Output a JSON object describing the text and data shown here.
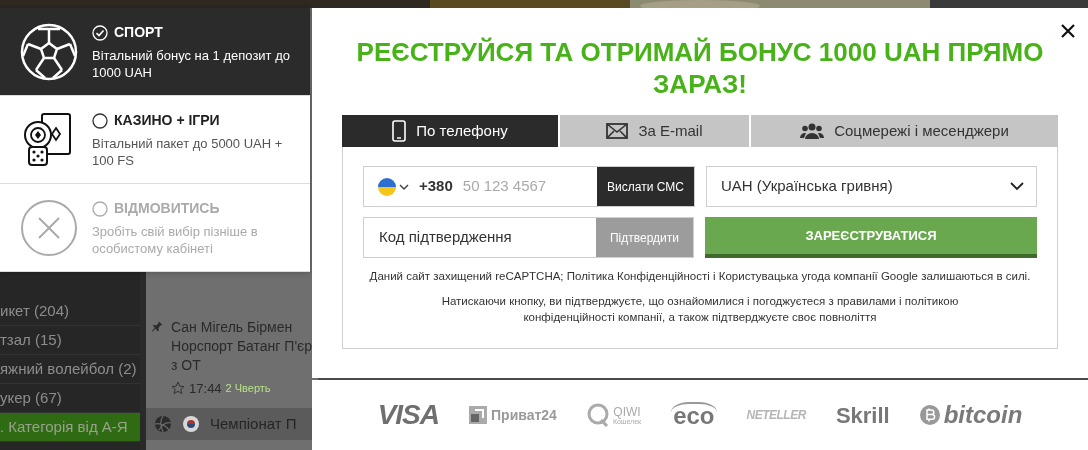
{
  "background": {
    "sidebar_items": [
      {
        "label": "икет (204)",
        "selected": false
      },
      {
        "label": "тзал (15)",
        "selected": false
      },
      {
        "label": "яжний волейбол (2)",
        "selected": false
      },
      {
        "label": "укер (67)",
        "selected": false
      },
      {
        "label": ". Категорія від А-Я",
        "selected": true
      }
    ],
    "event": {
      "lines": [
        "Сан Мігель Бірмен",
        "Норспорт Батанг П'єр",
        "з ОТ"
      ],
      "time": "17:44",
      "period": "2 Чверть"
    },
    "league": {
      "name": "Чемпіонат П"
    }
  },
  "bonus_options": [
    {
      "kind": "sport",
      "title": "СПОРТ",
      "description": "Вітальний бонус на 1 депозит до 1000 UAH",
      "selected": true
    },
    {
      "kind": "casino",
      "title": "КАЗИНО + ІГРИ",
      "description": "Вітальний пакет до 5000 UAH + 100 FS",
      "selected": false
    },
    {
      "kind": "decline",
      "title": "ВІДМОВИТИСЬ",
      "description": "Зробіть свій вибір пізніше в особистому кабінеті",
      "selected": false
    }
  ],
  "modal": {
    "title": "РЕЄСТРУЙСЯ ТА ОТРИМАЙ БОНУС 1000 UAH ПРЯМО ЗАРАЗ!",
    "tabs": [
      {
        "kind": "phone",
        "label": "По телефону",
        "selected": true
      },
      {
        "kind": "email",
        "label": "За E-mail",
        "selected": false
      },
      {
        "kind": "social",
        "label": "Соцмережі і месенджери",
        "selected": false
      }
    ],
    "phone": {
      "country_code": "+380",
      "placeholder": "50 123 4567",
      "send_button": "Вислати СМС"
    },
    "currency": {
      "value": "UAH (Українська гривня)"
    },
    "code": {
      "placeholder": "Код підтвердження",
      "confirm_button": "Підтвердити"
    },
    "submit_button": "ЗАРЕЄСТРУВАТИСЯ",
    "notes": [
      [
        {
          "text": "Даний сайт захищений reCAPTCHA; ",
          "kind": "text"
        },
        {
          "text": "Політика Конфіденційності",
          "kind": "link"
        },
        {
          "text": " і ",
          "kind": "text"
        },
        {
          "text": "Користувацька угода",
          "kind": "link"
        },
        {
          "text": " компанії Google залишаються в силі.",
          "kind": "text"
        }
      ],
      [
        {
          "text": "Натискаючи кнопку, ви підтверджуєте, що ознайомилися і погоджуєтеся з ",
          "kind": "text"
        },
        {
          "text": "правилами",
          "kind": "link"
        },
        {
          "text": " і ",
          "kind": "text"
        },
        {
          "text": "політикою",
          "kind": "link"
        },
        {
          "text": " конфіденційності компанії, а також підтверджуєте своє повноліття",
          "kind": "text"
        }
      ]
    ]
  },
  "payment_methods": [
    {
      "kind": "visa",
      "text": "VISA"
    },
    {
      "kind": "privat",
      "text": "Приват24"
    },
    {
      "kind": "qiwi",
      "text": "QIWI",
      "subtext": "Кошелек"
    },
    {
      "kind": "eco",
      "text": "eco"
    },
    {
      "kind": "neteller",
      "text": "NETELLER"
    },
    {
      "kind": "skrill",
      "text": "Skrill"
    },
    {
      "kind": "bitcoin",
      "text": "bitcoin"
    }
  ]
}
